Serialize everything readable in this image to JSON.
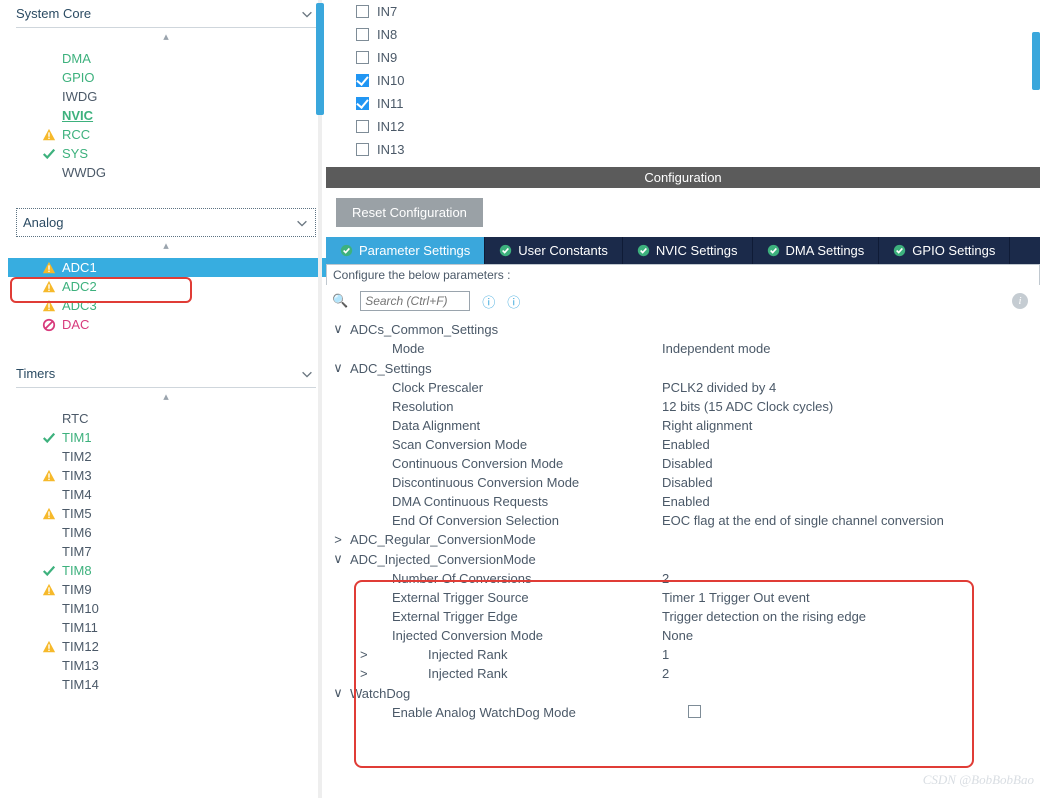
{
  "sidebar": {
    "cat_system": "System Core",
    "cat_analog": "Analog",
    "cat_timers": "Timers",
    "system_items": [
      {
        "label": "DMA",
        "cls": "green",
        "icon": ""
      },
      {
        "label": "GPIO",
        "cls": "green",
        "icon": ""
      },
      {
        "label": "IWDG",
        "cls": "normal",
        "icon": ""
      },
      {
        "label": "NVIC",
        "cls": "green bold",
        "icon": ""
      },
      {
        "label": "RCC",
        "cls": "green",
        "icon": "warn"
      },
      {
        "label": "SYS",
        "cls": "green",
        "icon": "check"
      },
      {
        "label": "WWDG",
        "cls": "normal",
        "icon": ""
      }
    ],
    "analog_items": [
      {
        "label": "ADC1",
        "cls": "sel",
        "icon": "warn"
      },
      {
        "label": "ADC2",
        "cls": "green",
        "icon": "warn"
      },
      {
        "label": "ADC3",
        "cls": "green",
        "icon": "warn"
      },
      {
        "label": "DAC",
        "cls": "magenta",
        "icon": "ban"
      }
    ],
    "timer_items": [
      {
        "label": "RTC",
        "cls": "normal",
        "icon": ""
      },
      {
        "label": "TIM1",
        "cls": "green",
        "icon": "check"
      },
      {
        "label": "TIM2",
        "cls": "normal",
        "icon": ""
      },
      {
        "label": "TIM3",
        "cls": "normal",
        "icon": "warn"
      },
      {
        "label": "TIM4",
        "cls": "normal",
        "icon": ""
      },
      {
        "label": "TIM5",
        "cls": "normal",
        "icon": "warn"
      },
      {
        "label": "TIM6",
        "cls": "normal",
        "icon": ""
      },
      {
        "label": "TIM7",
        "cls": "normal",
        "icon": ""
      },
      {
        "label": "TIM8",
        "cls": "green",
        "icon": "check"
      },
      {
        "label": "TIM9",
        "cls": "normal",
        "icon": "warn"
      },
      {
        "label": "TIM10",
        "cls": "normal",
        "icon": ""
      },
      {
        "label": "TIM11",
        "cls": "normal",
        "icon": ""
      },
      {
        "label": "TIM12",
        "cls": "normal",
        "icon": "warn"
      },
      {
        "label": "TIM13",
        "cls": "normal",
        "icon": ""
      },
      {
        "label": "TIM14",
        "cls": "normal",
        "icon": ""
      }
    ]
  },
  "channels": [
    {
      "label": "IN7",
      "on": false
    },
    {
      "label": "IN8",
      "on": false
    },
    {
      "label": "IN9",
      "on": false
    },
    {
      "label": "IN10",
      "on": true
    },
    {
      "label": "IN11",
      "on": true
    },
    {
      "label": "IN12",
      "on": false
    },
    {
      "label": "IN13",
      "on": false
    }
  ],
  "config_header": "Configuration",
  "reset_btn": "Reset Configuration",
  "tabs": [
    "Parameter Settings",
    "User Constants",
    "NVIC Settings",
    "DMA Settings",
    "GPIO Settings"
  ],
  "cfg_desc": "Configure the below parameters :",
  "search_placeholder": "Search (Ctrl+F)",
  "groups": {
    "common": {
      "title": "ADCs_Common_Settings",
      "rows": [
        [
          "Mode",
          "Independent mode"
        ]
      ]
    },
    "adc": {
      "title": "ADC_Settings",
      "rows": [
        [
          "Clock Prescaler",
          "PCLK2 divided by 4"
        ],
        [
          "Resolution",
          "12 bits (15 ADC Clock cycles)"
        ],
        [
          "Data Alignment",
          "Right alignment"
        ],
        [
          "Scan Conversion Mode",
          "Enabled"
        ],
        [
          "Continuous Conversion Mode",
          "Disabled"
        ],
        [
          "Discontinuous Conversion Mode",
          "Disabled"
        ],
        [
          "DMA Continuous Requests",
          "Enabled"
        ],
        [
          "End Of Conversion Selection",
          "EOC flag at the end of single channel conversion"
        ]
      ]
    },
    "regular": {
      "title": "ADC_Regular_ConversionMode"
    },
    "injected": {
      "title": "ADC_Injected_ConversionMode",
      "rows": [
        [
          "Number Of Conversions",
          "2"
        ],
        [
          "External Trigger Source",
          "Timer 1 Trigger Out event"
        ],
        [
          "External Trigger Edge",
          "Trigger detection on the rising edge"
        ],
        [
          "Injected Conversion Mode",
          "None"
        ]
      ],
      "ranks": [
        [
          "Injected Rank",
          "1"
        ],
        [
          "Injected Rank",
          "2"
        ]
      ]
    },
    "watchdog": {
      "title": "WatchDog",
      "row_label": "Enable Analog WatchDog Mode"
    }
  },
  "watermark": "CSDN @BobBobBao"
}
